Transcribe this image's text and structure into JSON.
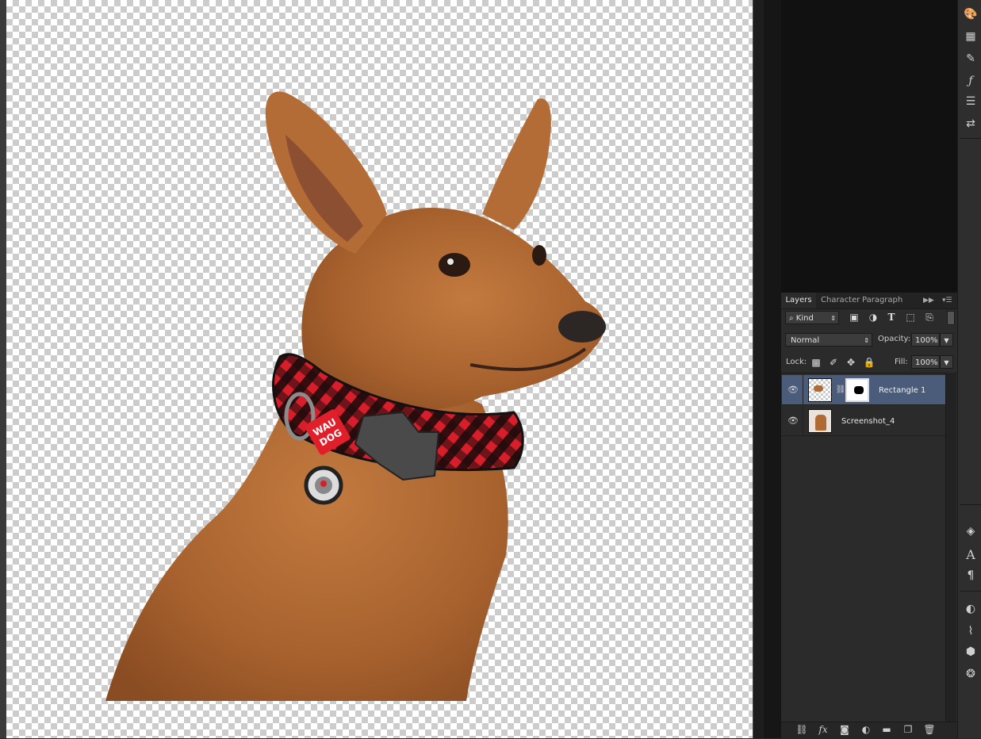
{
  "panel": {
    "tabs": [
      {
        "label": "Layers"
      },
      {
        "label": "Character"
      },
      {
        "label": "Paragraph"
      }
    ],
    "filter": {
      "kind_label": "Kind"
    },
    "blend_mode": "Normal",
    "opacity_label": "Opacity:",
    "opacity_value": "100%",
    "lock_label": "Lock:",
    "fill_label": "Fill:",
    "fill_value": "100%",
    "layers": [
      {
        "name": "Rectangle 1",
        "selected": true
      },
      {
        "name": "Screenshot_4",
        "selected": false
      }
    ]
  },
  "canvas": {
    "collar_tag_text": [
      "WAU",
      "DOG"
    ]
  },
  "colors": {
    "app_bg": "#282828",
    "selected_layer": "#4b5c7a",
    "dog_fur": "#b06a34",
    "collar_red": "#d81e2a"
  },
  "icons": {
    "filter_types": [
      "image-filter-icon",
      "adjustment-filter-icon",
      "type-filter-icon",
      "shape-filter-icon",
      "smart-object-filter-icon"
    ],
    "lock": [
      "lock-pixels-icon",
      "lock-brush-icon",
      "lock-position-icon",
      "lock-all-icon"
    ],
    "bottom": [
      "link-layers-icon",
      "fx-icon",
      "add-mask-icon",
      "adjustment-layer-icon",
      "group-folder-icon",
      "new-layer-icon",
      "trash-icon"
    ]
  }
}
